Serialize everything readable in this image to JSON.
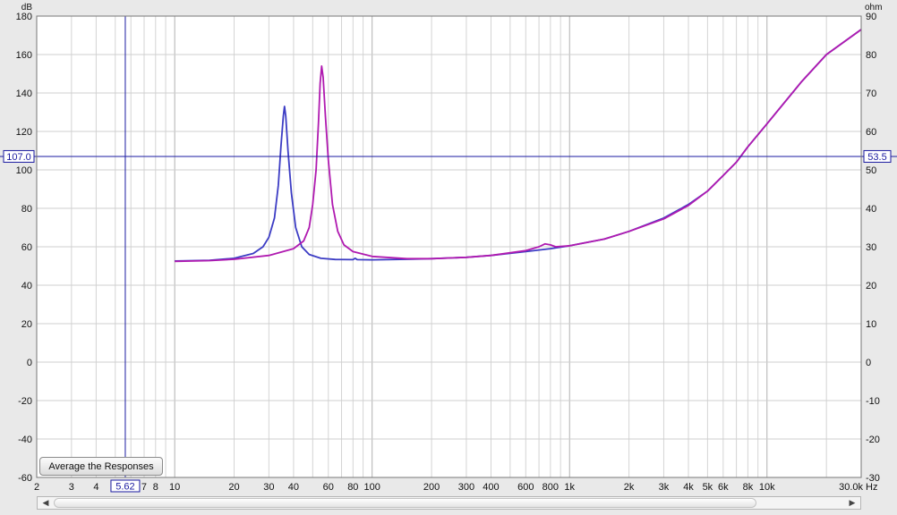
{
  "chart_data": {
    "type": "line",
    "xscale": "log",
    "xlim": [
      2,
      30000
    ],
    "x_unit": "Hz",
    "y_left_label": "dB",
    "y_right_label": "ohm",
    "ylim_left": [
      -60,
      180
    ],
    "ylim_right": [
      -30,
      90
    ],
    "grid": true,
    "x_tick_labels": [
      {
        "v": 2,
        "t": "2"
      },
      {
        "v": 3,
        "t": "3"
      },
      {
        "v": 4,
        "t": "4"
      },
      {
        "v": 7,
        "t": "7"
      },
      {
        "v": 8,
        "t": "8"
      },
      {
        "v": 10,
        "t": "10"
      },
      {
        "v": 20,
        "t": "20"
      },
      {
        "v": 30,
        "t": "30"
      },
      {
        "v": 40,
        "t": "40"
      },
      {
        "v": 60,
        "t": "60"
      },
      {
        "v": 80,
        "t": "80"
      },
      {
        "v": 100,
        "t": "100"
      },
      {
        "v": 200,
        "t": "200"
      },
      {
        "v": 300,
        "t": "300"
      },
      {
        "v": 400,
        "t": "400"
      },
      {
        "v": 600,
        "t": "600"
      },
      {
        "v": 800,
        "t": "800"
      },
      {
        "v": 1000,
        "t": "1k"
      },
      {
        "v": 2000,
        "t": "2k"
      },
      {
        "v": 3000,
        "t": "3k"
      },
      {
        "v": 4000,
        "t": "4k"
      },
      {
        "v": 5000,
        "t": "5k"
      },
      {
        "v": 6000,
        "t": "6k"
      },
      {
        "v": 8000,
        "t": "8k"
      },
      {
        "v": 10000,
        "t": "10k"
      },
      {
        "v": 30000,
        "t": "30.0k"
      }
    ],
    "y_left_ticks": [
      180,
      160,
      140,
      120,
      100,
      80,
      60,
      40,
      20,
      0,
      -20,
      -40,
      -60
    ],
    "y_right_ticks": [
      90,
      80,
      70,
      60,
      50,
      40,
      30,
      20,
      10,
      0,
      -10,
      -20,
      -30
    ],
    "cursor": {
      "x": 5.62,
      "x_label": "5.62",
      "y_left": 107.0,
      "y_left_label": "107.0",
      "y_right_label": "53.5"
    },
    "series": [
      {
        "color": "#3c3cc4",
        "points": [
          [
            10,
            52.6
          ],
          [
            15,
            53.0
          ],
          [
            20,
            54.0
          ],
          [
            25,
            56.5
          ],
          [
            28,
            60
          ],
          [
            30,
            65
          ],
          [
            32,
            75
          ],
          [
            33.5,
            92
          ],
          [
            34.5,
            112
          ],
          [
            35.5,
            128
          ],
          [
            36,
            133
          ],
          [
            36.5,
            128
          ],
          [
            37.5,
            110
          ],
          [
            39,
            88
          ],
          [
            41,
            70
          ],
          [
            44,
            60
          ],
          [
            48,
            56
          ],
          [
            55,
            54
          ],
          [
            65,
            53.4
          ],
          [
            80,
            53.3
          ],
          [
            82,
            54
          ],
          [
            84,
            53.3
          ],
          [
            100,
            53.2
          ],
          [
            150,
            53.5
          ],
          [
            200,
            53.8
          ],
          [
            300,
            54.5
          ],
          [
            400,
            55.5
          ],
          [
            600,
            57.5
          ],
          [
            800,
            59
          ],
          [
            1000,
            60.5
          ],
          [
            1500,
            64
          ],
          [
            2000,
            68
          ],
          [
            3000,
            75
          ],
          [
            4000,
            82
          ],
          [
            5000,
            89
          ],
          [
            6000,
            97
          ],
          [
            7000,
            104
          ],
          [
            8000,
            112
          ],
          [
            10000,
            124
          ],
          [
            15000,
            146
          ],
          [
            20000,
            160
          ],
          [
            30000,
            173
          ]
        ]
      },
      {
        "color": "#b01ab0",
        "points": [
          [
            10,
            52.4
          ],
          [
            15,
            52.8
          ],
          [
            20,
            53.5
          ],
          [
            30,
            55.5
          ],
          [
            40,
            59
          ],
          [
            45,
            63
          ],
          [
            48,
            70
          ],
          [
            50,
            82
          ],
          [
            52,
            100
          ],
          [
            53.5,
            125
          ],
          [
            54.5,
            145
          ],
          [
            55.5,
            154
          ],
          [
            56.5,
            148
          ],
          [
            58,
            128
          ],
          [
            60,
            105
          ],
          [
            63,
            82
          ],
          [
            67,
            68
          ],
          [
            72,
            61
          ],
          [
            80,
            57.5
          ],
          [
            100,
            55
          ],
          [
            150,
            53.8
          ],
          [
            200,
            53.8
          ],
          [
            300,
            54.5
          ],
          [
            400,
            55.5
          ],
          [
            600,
            58
          ],
          [
            700,
            60
          ],
          [
            750,
            61.5
          ],
          [
            800,
            61
          ],
          [
            850,
            60
          ],
          [
            1000,
            60.5
          ],
          [
            1500,
            64
          ],
          [
            2000,
            68
          ],
          [
            3000,
            74.5
          ],
          [
            4000,
            81.5
          ],
          [
            5000,
            89
          ],
          [
            6000,
            97
          ],
          [
            7000,
            104
          ],
          [
            8000,
            112
          ],
          [
            10000,
            124
          ],
          [
            15000,
            146
          ],
          [
            20000,
            160
          ],
          [
            30000,
            173
          ]
        ]
      }
    ]
  },
  "button": {
    "average_label": "Average the Responses"
  },
  "scrollbar": {
    "left_arrow": "◀",
    "right_arrow": "▶"
  }
}
